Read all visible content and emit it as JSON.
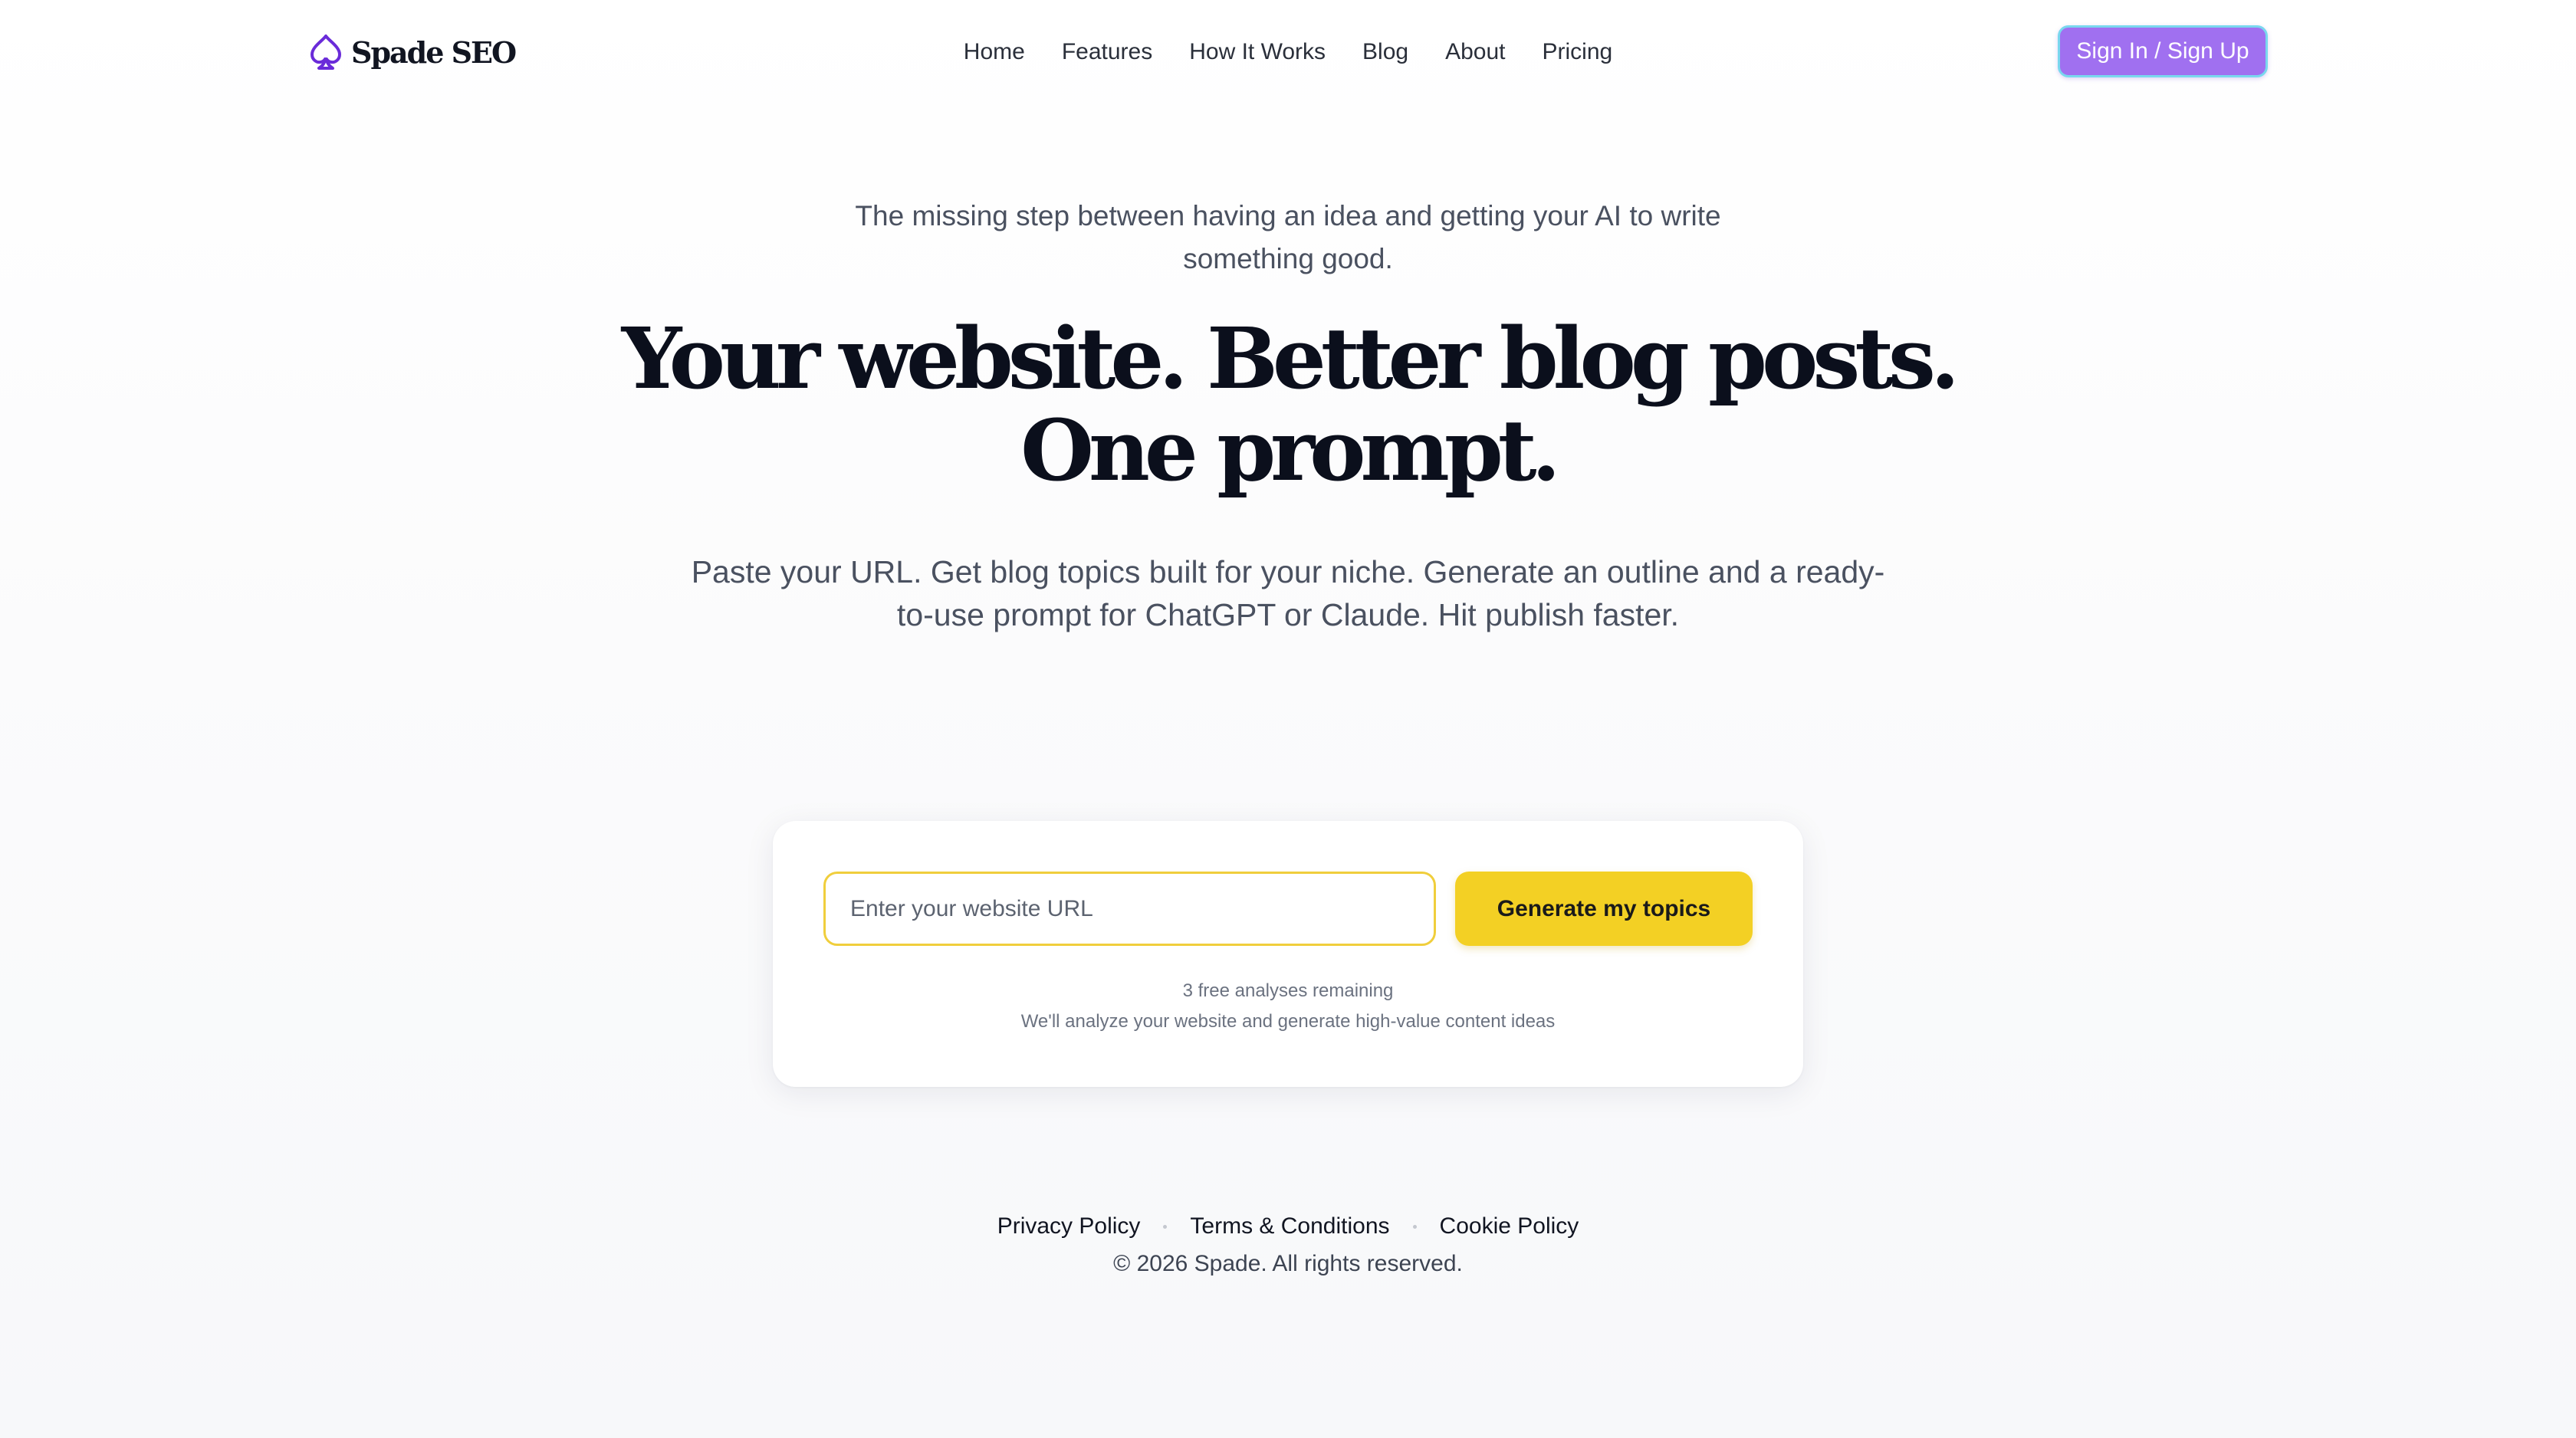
{
  "nav": {
    "brand": "Spade SEO",
    "links": [
      {
        "label": "Home"
      },
      {
        "label": "Features"
      },
      {
        "label": "How It Works"
      },
      {
        "label": "Blog"
      },
      {
        "label": "About"
      },
      {
        "label": "Pricing"
      }
    ],
    "signin_label": "Sign In / Sign Up"
  },
  "hero": {
    "eyebrow": "The missing step between having an idea and getting your AI to write something good.",
    "headline_line1": "Your website. Better blog posts.",
    "headline_line2": "One prompt.",
    "subhead": "Paste your URL. Get blog topics built for your niche. Generate an outline and a ready-to-use prompt for ChatGPT or Claude. Hit publish faster."
  },
  "form": {
    "url_placeholder": "Enter your website URL",
    "url_value": "",
    "submit_label": "Generate my topics",
    "remaining": "3 free analyses remaining",
    "note": "We'll analyze your website and generate high-value content ideas"
  },
  "footer": {
    "links": [
      {
        "label": "Privacy Policy"
      },
      {
        "label": "Terms & Conditions"
      },
      {
        "label": "Cookie Policy"
      }
    ],
    "copyright": "© 2026 Spade. All rights reserved."
  },
  "colors": {
    "brand_purple": "#6a2bd9",
    "signin_bg": "#a070f0",
    "signin_border": "#79d8ee",
    "cta_yellow": "#f3d024",
    "input_border": "#f0ce3c"
  },
  "icons": {
    "logo": "spade-icon"
  }
}
